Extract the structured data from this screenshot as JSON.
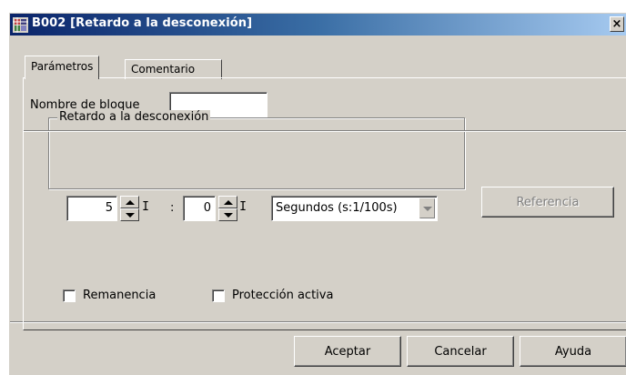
{
  "window": {
    "title": "B002 [Retardo a la desconexión]",
    "close_symbol": "×",
    "icon": "logo-block-icon",
    "colors": {
      "titlebar_start": "#0a246a",
      "titlebar_end": "#a6caf0",
      "face": "#d4d0c8"
    }
  },
  "tabs": [
    {
      "label": "Parámetros",
      "active": true
    },
    {
      "label": "Comentario",
      "active": false
    }
  ],
  "params": {
    "block_name_label": "Nombre de bloque",
    "block_name_value": "",
    "group_title": "Retardo a la desconexión",
    "time_major": "5",
    "separator": ":",
    "time_minor": "0",
    "spin_suffix": "I",
    "unit_selected": "Segundos (s:1/100s)",
    "reference_button": "Referencia",
    "retentive_label": "Remanencia",
    "retentive_checked": false,
    "protection_label": "Protección activa",
    "protection_checked": false
  },
  "footer": {
    "ok_label": "Aceptar",
    "cancel_label": "Cancelar",
    "help_label": "Ayuda"
  }
}
